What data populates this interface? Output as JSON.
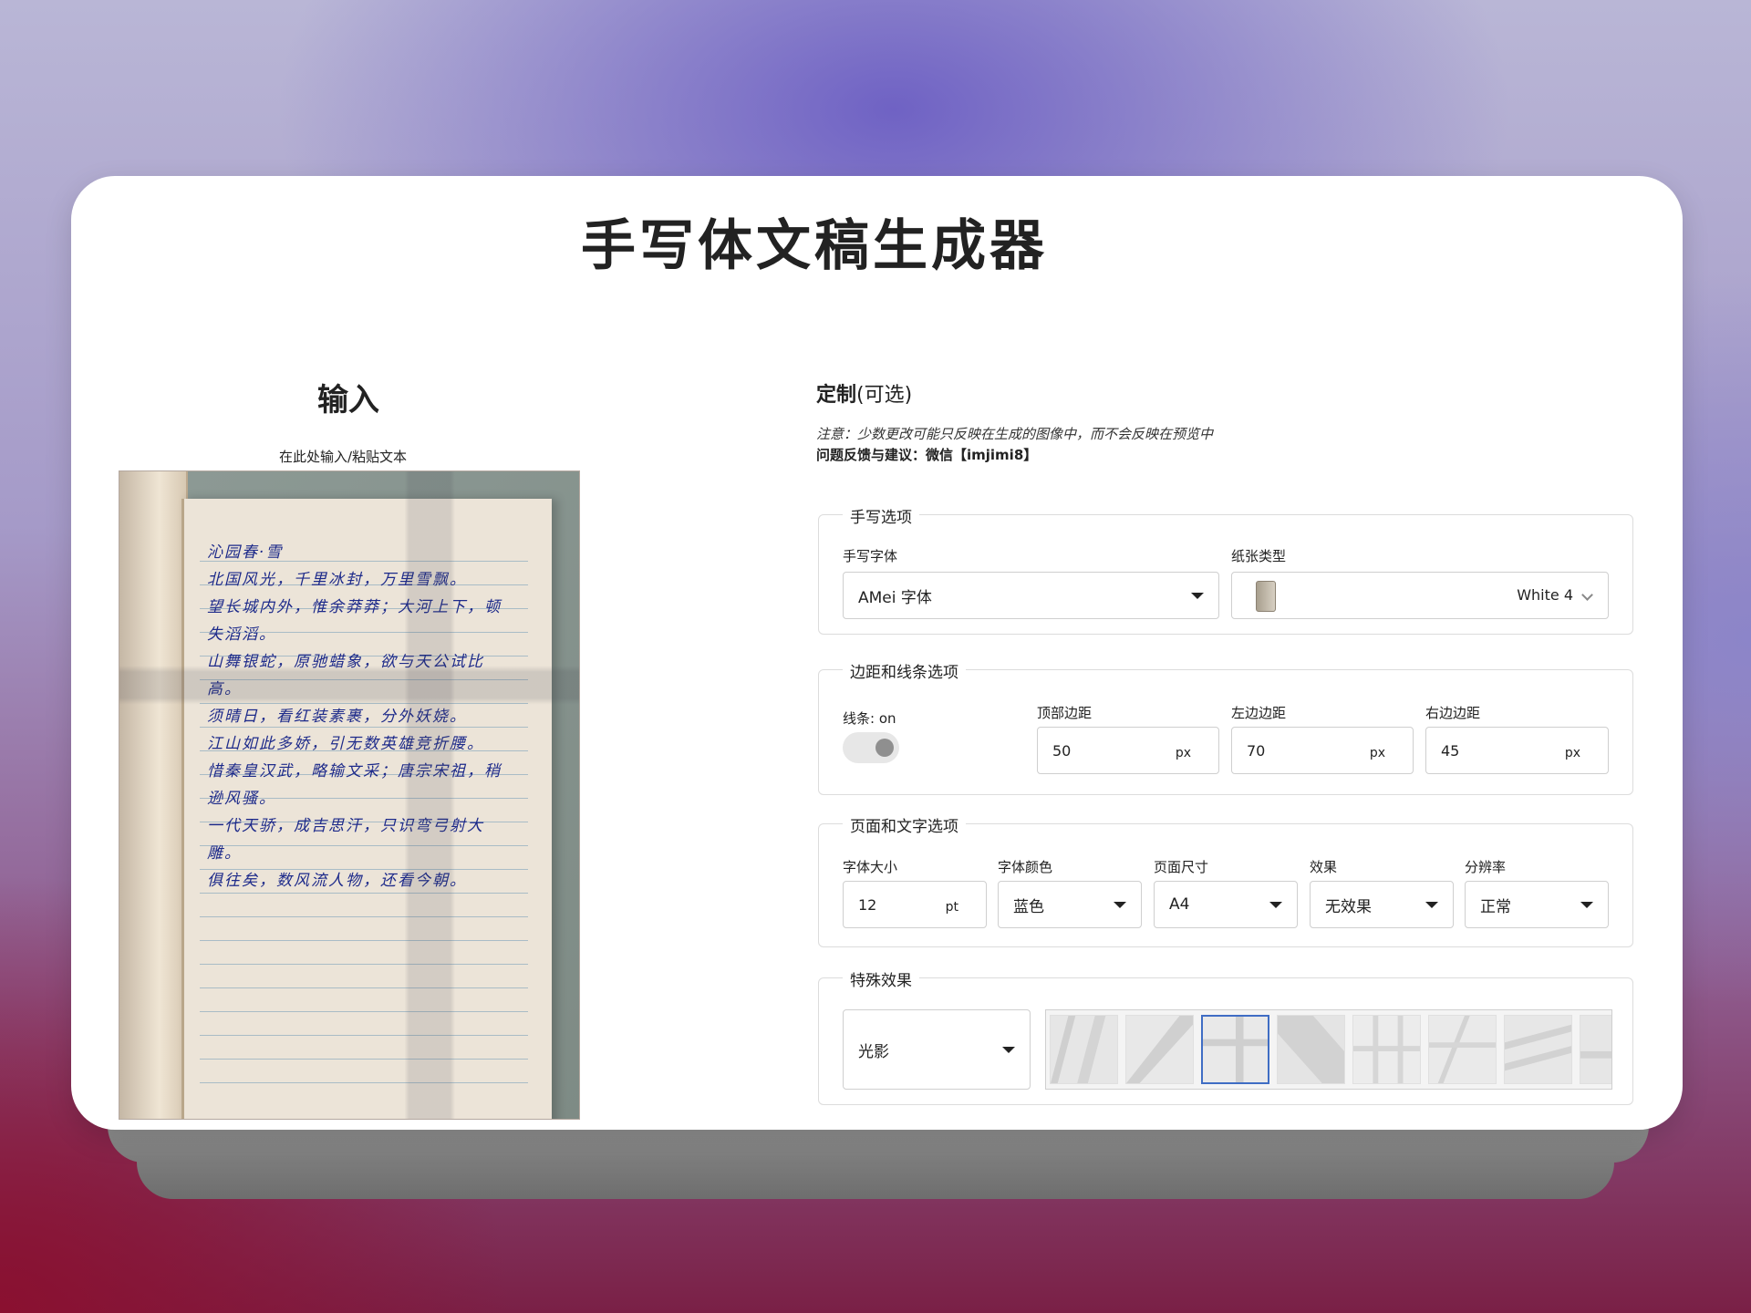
{
  "title": "手写体文稿生成器",
  "input": {
    "heading": "输入",
    "hint": "在此处输入/粘贴文本",
    "preview_lines": [
      "沁园春·雪",
      "北国风光，千里冰封，万里雪飘。",
      "望长城内外，惟余莽莽；大河上下，顿",
      "失滔滔。",
      "山舞银蛇，原驰蜡象，欲与天公试比",
      "高。",
      "须晴日，看红装素裹，分外妖娆。",
      "江山如此多娇，引无数英雄竞折腰。",
      "惜秦皇汉武，略输文采；唐宗宋祖，稍",
      "逊风骚。",
      "一代天骄，成吉思汗，只识弯弓射大",
      "雕。",
      "俱往矣，数风流人物，还看今朝。"
    ]
  },
  "customize": {
    "heading_bold": "定制",
    "heading_suffix": "(可选)",
    "notice": "注意：少数更改可能只反映在生成的图像中，而不会反映在预览中",
    "feedback": "问题反馈与建议：微信【imjimi8】"
  },
  "handwriting_options": {
    "legend": "手写选项",
    "font_label": "手写字体",
    "font_value": "AMei 字体",
    "paper_label": "纸张类型",
    "paper_value": "White 4"
  },
  "margin_options": {
    "legend": "边距和线条选项",
    "lines_label": "线条: on",
    "lines_on": true,
    "top_label": "顶部边距",
    "top_value": "50",
    "left_label": "左边边距",
    "left_value": "70",
    "right_label": "右边边距",
    "right_value": "45",
    "unit": "px"
  },
  "page_text_options": {
    "legend": "页面和文字选项",
    "size_label": "字体大小",
    "size_value": "12",
    "size_unit": "pt",
    "color_label": "字体颜色",
    "color_value": "蓝色",
    "page_size_label": "页面尺寸",
    "page_size_value": "A4",
    "effect_label": "效果",
    "effect_value": "无效果",
    "resolution_label": "分辨率",
    "resolution_value": "正常"
  },
  "special_effects": {
    "legend": "特殊效果",
    "type_value": "光影",
    "selected_index": 2
  },
  "colors": {
    "ink": "#1d2a8a",
    "select_highlight": "#3f6dc4"
  }
}
